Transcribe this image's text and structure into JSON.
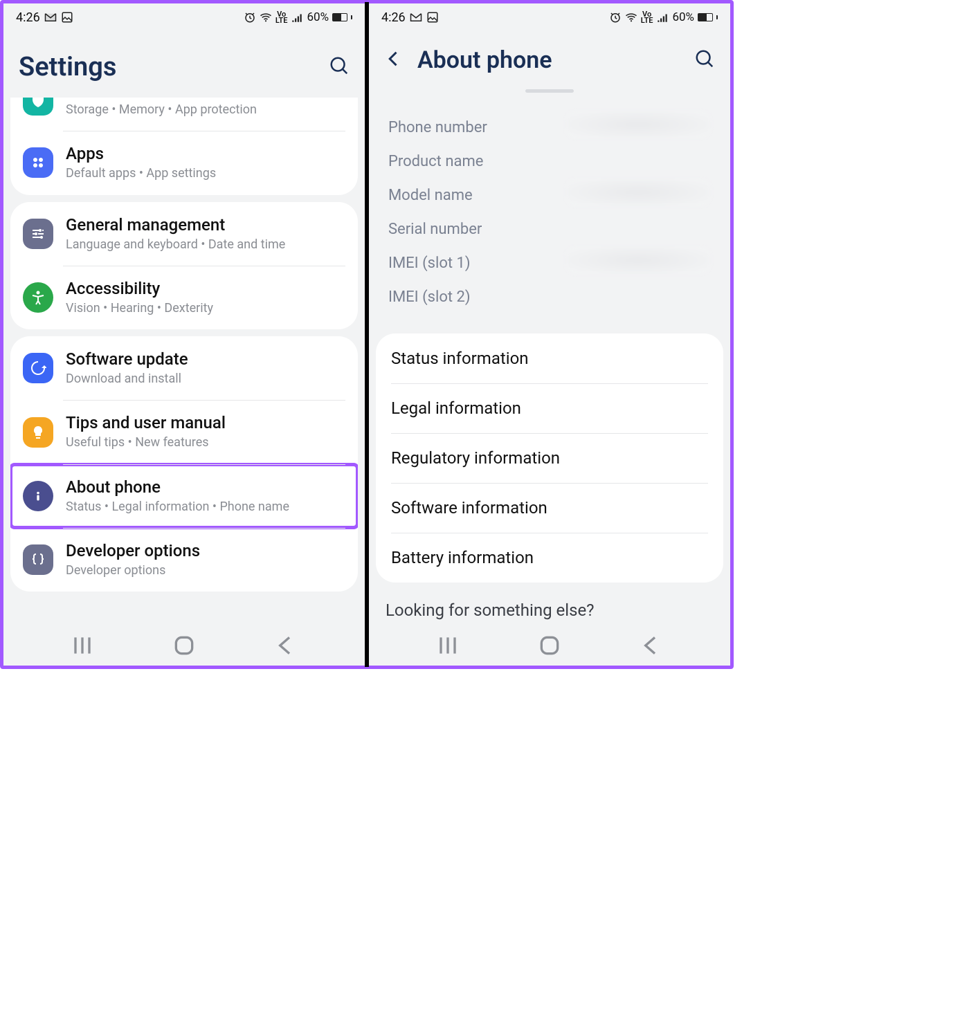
{
  "statusbar": {
    "time": "4:26",
    "battery_pct": "60%",
    "volte": "Vo\nLTE"
  },
  "left": {
    "title": "Settings",
    "partial_row": {
      "sub": "Storage  •  Memory  •  App protection"
    },
    "groups": [
      {
        "rows": [
          {
            "title": "Apps",
            "sub": "Default apps  •  App settings",
            "color": "#4a6cf5",
            "icon": "apps"
          }
        ],
        "partial_above": true
      },
      {
        "rows": [
          {
            "title": "General management",
            "sub": "Language and keyboard  •  Date and time",
            "color": "#6b6f8e",
            "icon": "sliders"
          },
          {
            "title": "Accessibility",
            "sub": "Vision  •  Hearing  •  Dexterity",
            "color": "#2aa84a",
            "icon": "accessibility"
          }
        ]
      },
      {
        "rows": [
          {
            "title": "Software update",
            "sub": "Download and install",
            "color": "#3b66f5",
            "icon": "update"
          },
          {
            "title": "Tips and user manual",
            "sub": "Useful tips  •  New features",
            "color": "#f5a623",
            "icon": "bulb"
          },
          {
            "title": "About phone",
            "sub": "Status  •  Legal information  •  Phone name",
            "color": "#4a4e8f",
            "icon": "info",
            "highlight": true
          },
          {
            "title": "Developer options",
            "sub": "Developer options",
            "color": "#6b6f8e",
            "icon": "braces"
          }
        ]
      }
    ]
  },
  "right": {
    "title": "About phone",
    "info_labels": [
      "Phone number",
      "Product name",
      "Model name",
      "Serial number",
      "IMEI (slot 1)",
      "IMEI (slot 2)"
    ],
    "list_items": [
      "Status information",
      "Legal information",
      "Regulatory information",
      "Software information",
      "Battery information"
    ],
    "footer": "Looking for something else?"
  }
}
